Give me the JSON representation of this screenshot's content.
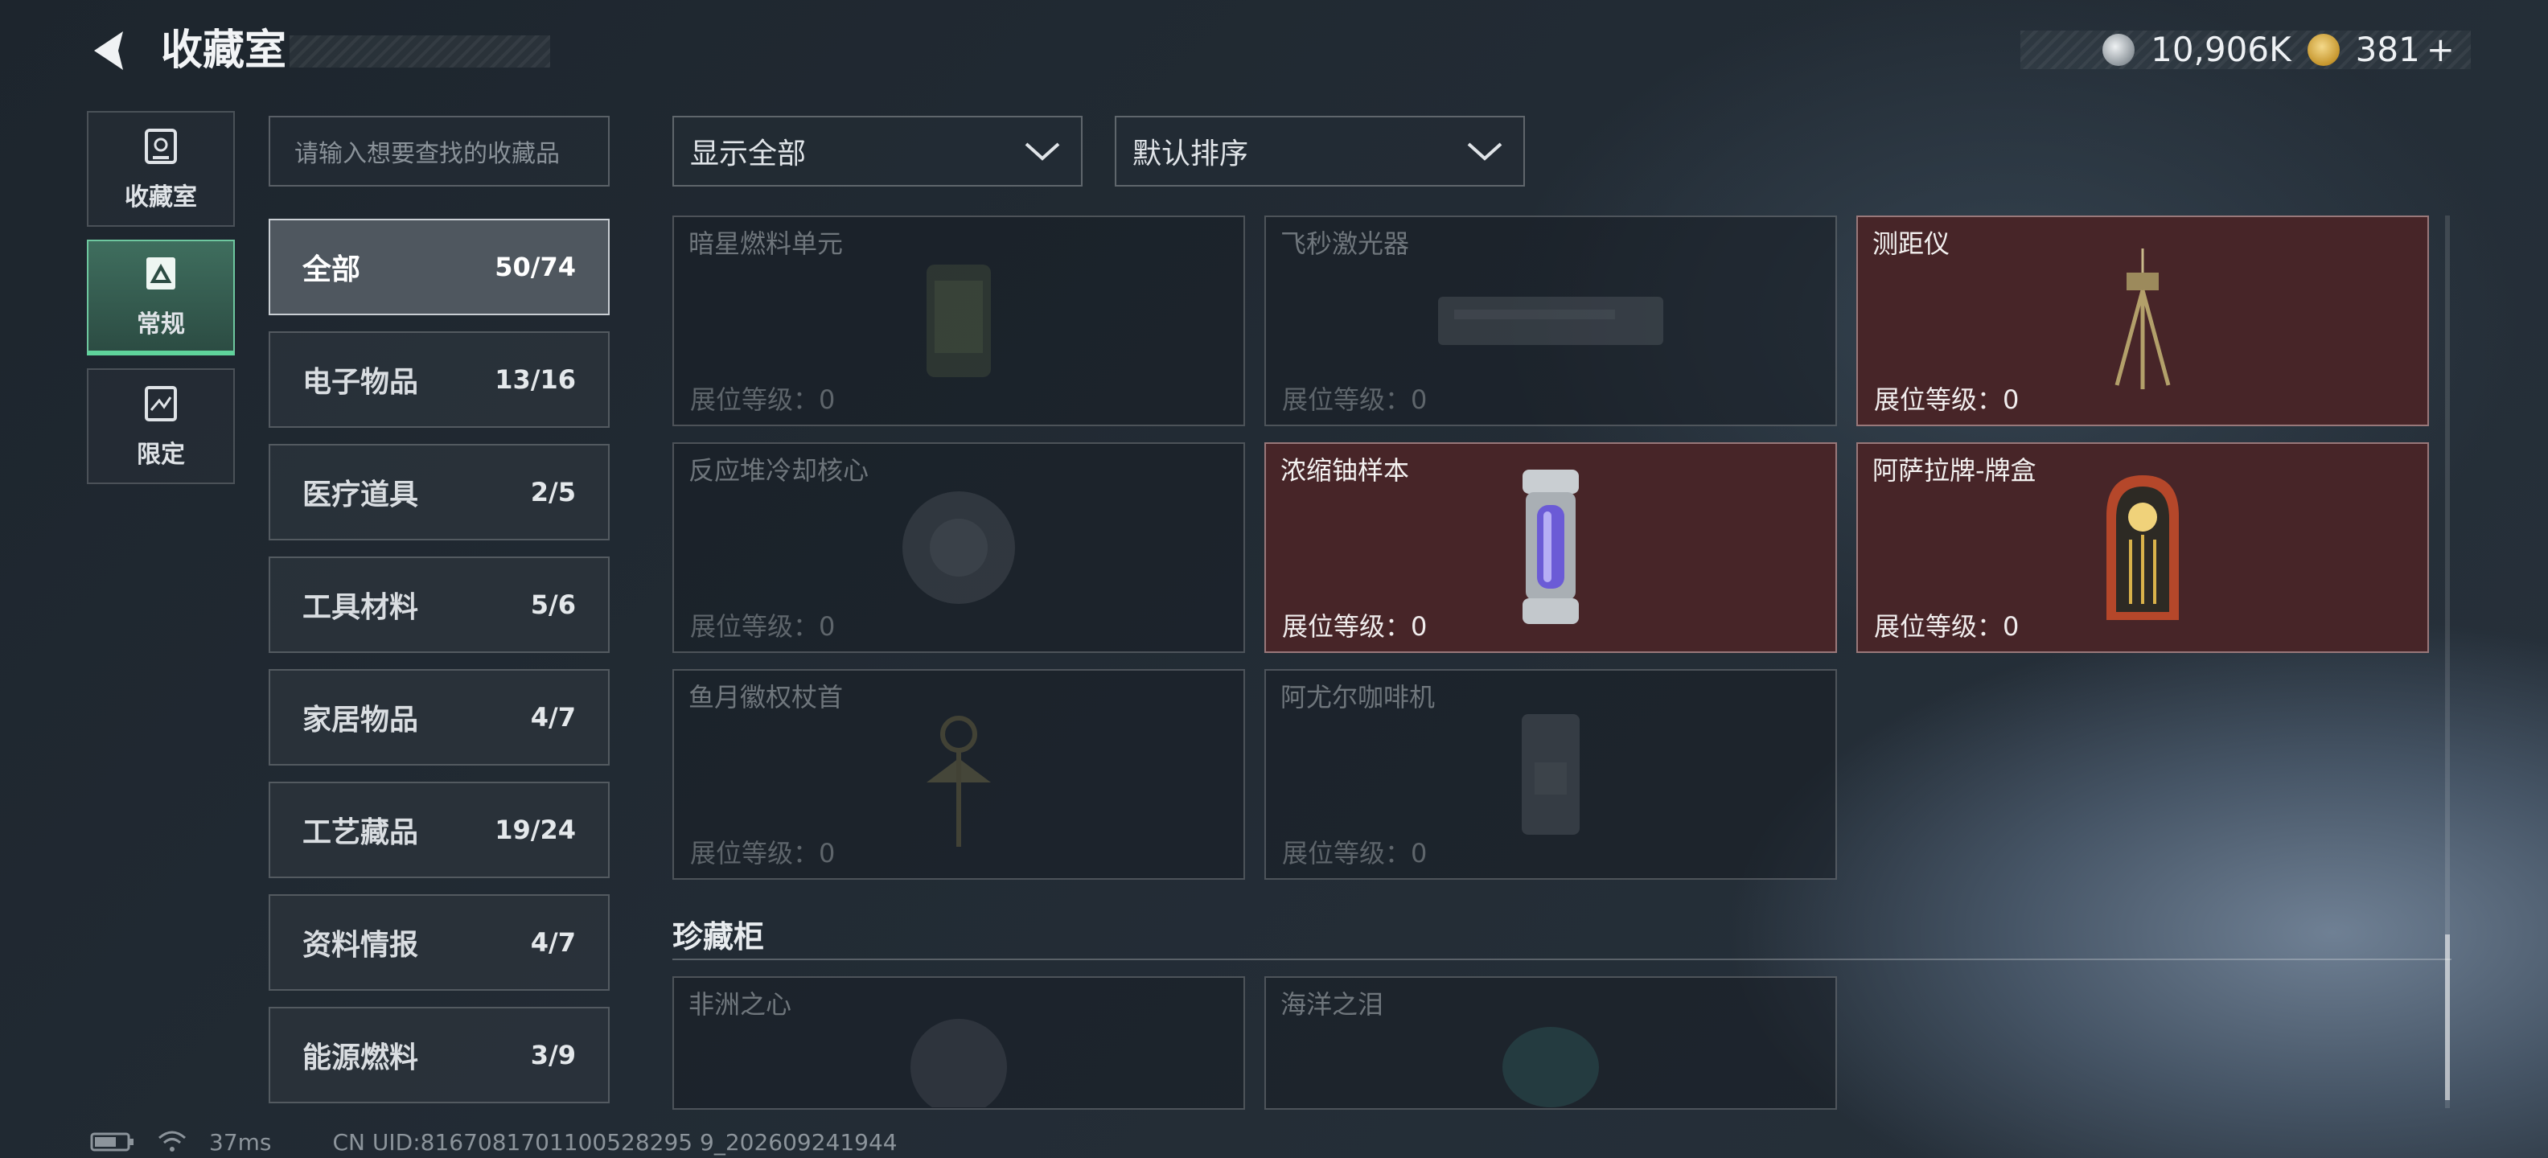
{
  "header": {
    "title": "收藏室"
  },
  "currency": [
    {
      "icon": "silver-coin-icon",
      "value": "10,906K",
      "color": "#cfd4d9"
    },
    {
      "icon": "gold-triangle-coin-icon",
      "value": "381",
      "plus": "+",
      "color": "#d9b24a"
    }
  ],
  "nav": [
    {
      "label": "收藏室",
      "icon": "collection-room-icon"
    },
    {
      "label": "常规",
      "icon": "regular-icon",
      "active": true
    },
    {
      "label": "限定",
      "icon": "limited-icon"
    }
  ],
  "search": {
    "placeholder": "请输入想要查找的收藏品"
  },
  "categories": [
    {
      "name": "全部",
      "count": "50/74",
      "active": true
    },
    {
      "name": "电子物品",
      "count": "13/16"
    },
    {
      "name": "医疗道具",
      "count": "2/5"
    },
    {
      "name": "工具材料",
      "count": "5/6"
    },
    {
      "name": "家居物品",
      "count": "4/7"
    },
    {
      "name": "工艺藏品",
      "count": "19/24"
    },
    {
      "name": "资料情报",
      "count": "4/7"
    },
    {
      "name": "能源燃料",
      "count": "3/9"
    }
  ],
  "filters": {
    "show": "显示全部",
    "sort": "默认排序"
  },
  "level_label": "展位等级：0",
  "items": [
    {
      "name": "暗星燃料单元",
      "owned": false,
      "art": "fuel-cell"
    },
    {
      "name": "飞秒激光器",
      "owned": false,
      "art": "laser"
    },
    {
      "name": "测距仪",
      "owned": true,
      "art": "tripod"
    },
    {
      "name": "反应堆冷却核心",
      "owned": false,
      "art": "reactor"
    },
    {
      "name": "浓缩铀样本",
      "owned": true,
      "art": "canister"
    },
    {
      "name": "阿萨拉牌-牌盒",
      "owned": true,
      "art": "card-box"
    },
    {
      "name": "鱼月徽权杖首",
      "owned": false,
      "art": "scepter"
    },
    {
      "name": "阿尤尔咖啡机",
      "owned": false,
      "art": "coffee"
    }
  ],
  "section": {
    "title": "珍藏柜"
  },
  "treasures": [
    {
      "name": "非洲之心",
      "owned": false,
      "art": "gem"
    },
    {
      "name": "海洋之泪",
      "owned": false,
      "art": "gem2"
    }
  ],
  "status": {
    "ping": "37ms",
    "uid": "CN UID:8167081701100528295 9_202609241944"
  }
}
